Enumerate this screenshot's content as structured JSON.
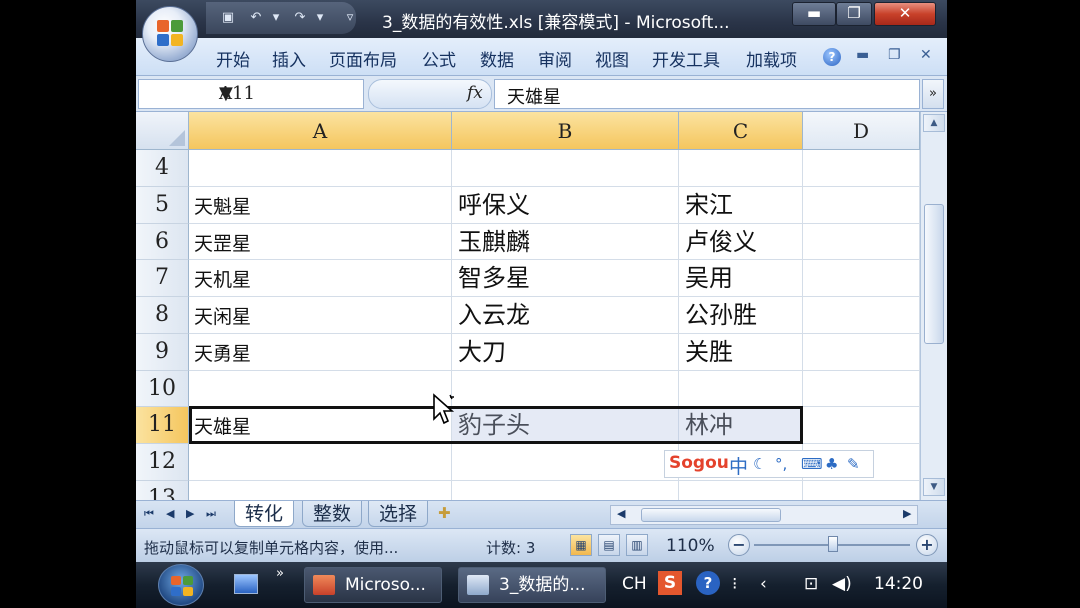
{
  "window": {
    "title": "3_数据的有效性.xls  [兼容模式] - Microsoft...",
    "minimize_label": "▬",
    "maximize_label": "❐",
    "close_label": "✕"
  },
  "ribbon": {
    "tabs": [
      "开始",
      "插入",
      "页面布局",
      "公式",
      "数据",
      "审阅",
      "视图",
      "开发工具",
      "加载项"
    ],
    "help_label": "?"
  },
  "formula_bar": {
    "name_box": "A11",
    "fx_label": "fx",
    "content": "天雄星"
  },
  "grid": {
    "columns": [
      "A",
      "B",
      "C",
      "D"
    ],
    "selected_columns": [
      "A",
      "B",
      "C"
    ],
    "rows": [
      {
        "num": "4",
        "a": "",
        "b": "",
        "c": ""
      },
      {
        "num": "5",
        "a": "天魁星",
        "b": "呼保义",
        "c": "宋江"
      },
      {
        "num": "6",
        "a": "天罡星",
        "b": "玉麒麟",
        "c": "卢俊义"
      },
      {
        "num": "7",
        "a": "天机星",
        "b": "智多星",
        "c": "吴用"
      },
      {
        "num": "8",
        "a": "天闲星",
        "b": "入云龙",
        "c": "公孙胜"
      },
      {
        "num": "9",
        "a": "天勇星",
        "b": "大刀",
        "c": "关胜"
      },
      {
        "num": "10",
        "a": "",
        "b": "",
        "c": ""
      },
      {
        "num": "11",
        "a": "天雄星",
        "b": "豹子头",
        "c": "林冲"
      },
      {
        "num": "12",
        "a": "",
        "b": "",
        "c": ""
      },
      {
        "num": "13",
        "a": "",
        "b": "",
        "c": ""
      }
    ],
    "active_row": "11"
  },
  "ime": {
    "logo": "Sogou",
    "mode": "中"
  },
  "sheets": {
    "tabs": [
      "转化",
      "整数",
      "选择"
    ],
    "active": "转化"
  },
  "status": {
    "message": "拖动鼠标可以复制单元格内容，使用...",
    "count": "计数: 3",
    "zoom": "110%"
  },
  "taskbar": {
    "windows": [
      "Microso...",
      "3_数据的..."
    ],
    "ime_label": "CH",
    "time": "14:20"
  },
  "colors": {
    "selected_header": "#f5c65e",
    "close_button": "#c8412a",
    "ribbon_bg": "#dbe6f4"
  }
}
